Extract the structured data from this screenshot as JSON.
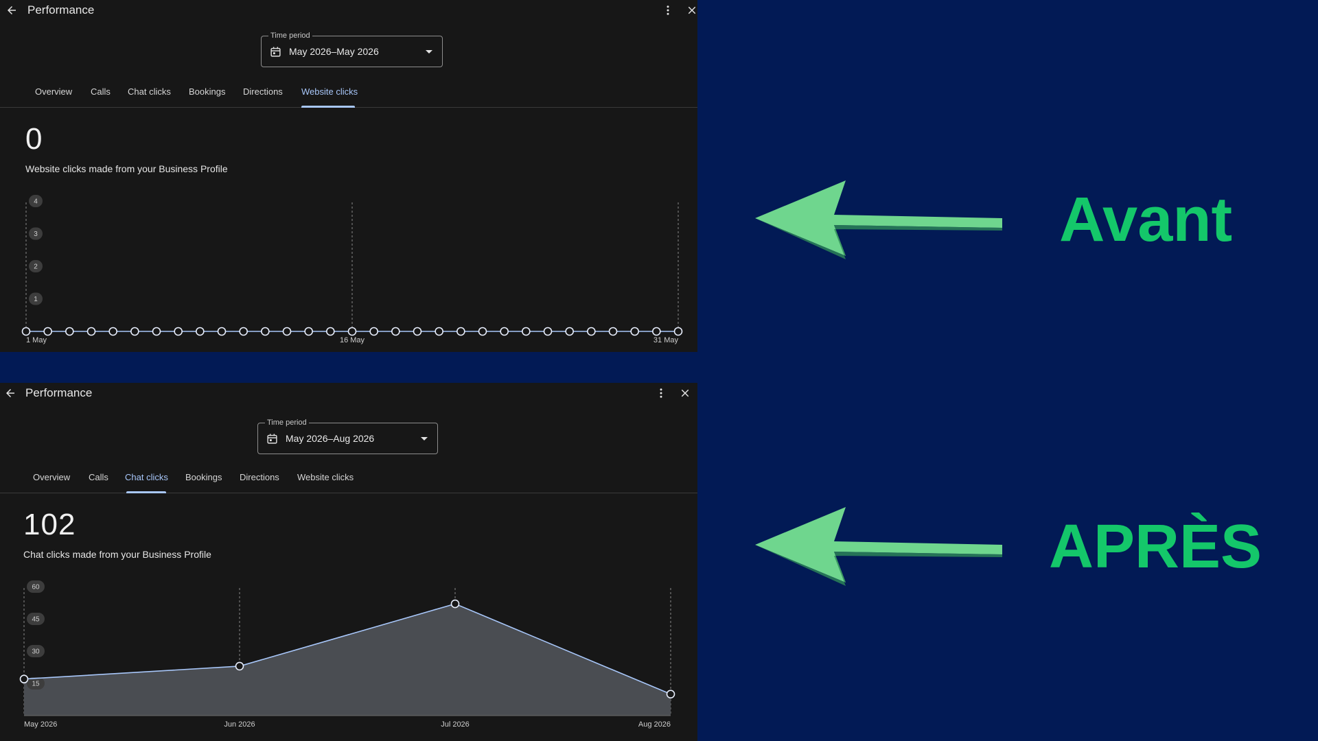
{
  "panels": [
    {
      "title": "Performance",
      "time_period": {
        "legend": "Time period",
        "value": "May 2026–May 2026"
      },
      "tabs": [
        {
          "label": "Overview",
          "active": false
        },
        {
          "label": "Calls",
          "active": false
        },
        {
          "label": "Chat clicks",
          "active": false
        },
        {
          "label": "Bookings",
          "active": false
        },
        {
          "label": "Directions",
          "active": false
        },
        {
          "label": "Website clicks",
          "active": true
        }
      ],
      "metric": {
        "value": "0",
        "label": "Website clicks made from your Business Profile"
      }
    },
    {
      "title": "Performance",
      "time_period": {
        "legend": "Time period",
        "value": "May 2026–Aug 2026"
      },
      "tabs": [
        {
          "label": "Overview",
          "active": false
        },
        {
          "label": "Calls",
          "active": false
        },
        {
          "label": "Chat clicks",
          "active": true
        },
        {
          "label": "Bookings",
          "active": false
        },
        {
          "label": "Directions",
          "active": false
        },
        {
          "label": "Website clicks",
          "active": false
        }
      ],
      "metric": {
        "value": "102",
        "label": "Chat clicks made from your Business Profile"
      }
    }
  ],
  "annotations": {
    "before": "Avant",
    "after": "APRÈS"
  },
  "colors": {
    "accent": "#a8c7fa",
    "annotation_green": "#14c76a",
    "arrow_green": "#6fd68e",
    "background": "#021a55",
    "panel": "#171717"
  },
  "icons": [
    "back-arrow-icon",
    "more-vert-icon",
    "close-icon",
    "calendar-icon",
    "dropdown-caret-icon"
  ],
  "chart_data": [
    {
      "type": "line",
      "x": [
        "1 May",
        "2 May",
        "3 May",
        "4 May",
        "5 May",
        "6 May",
        "7 May",
        "8 May",
        "9 May",
        "10 May",
        "11 May",
        "12 May",
        "13 May",
        "14 May",
        "15 May",
        "16 May",
        "17 May",
        "18 May",
        "19 May",
        "20 May",
        "21 May",
        "22 May",
        "23 May",
        "24 May",
        "25 May",
        "26 May",
        "27 May",
        "28 May",
        "29 May",
        "30 May",
        "31 May"
      ],
      "values": [
        0,
        0,
        0,
        0,
        0,
        0,
        0,
        0,
        0,
        0,
        0,
        0,
        0,
        0,
        0,
        0,
        0,
        0,
        0,
        0,
        0,
        0,
        0,
        0,
        0,
        0,
        0,
        0,
        0,
        0,
        0
      ],
      "x_tick_labels": [
        "1 May",
        "16 May",
        "31 May"
      ],
      "y_ticks": [
        1,
        2,
        3,
        4
      ],
      "ylim": [
        0,
        4
      ],
      "grid": "vertical dashed"
    },
    {
      "type": "area",
      "x": [
        "May 2026",
        "Jun 2026",
        "Jul 2026",
        "Aug 2026"
      ],
      "values": [
        17,
        23,
        52,
        10
      ],
      "x_tick_labels": [
        "May 2026",
        "Jun 2026",
        "Jul 2026",
        "Aug 2026"
      ],
      "y_ticks": [
        15,
        30,
        45,
        60
      ],
      "ylim": [
        0,
        60
      ],
      "grid": "vertical dashed"
    }
  ]
}
